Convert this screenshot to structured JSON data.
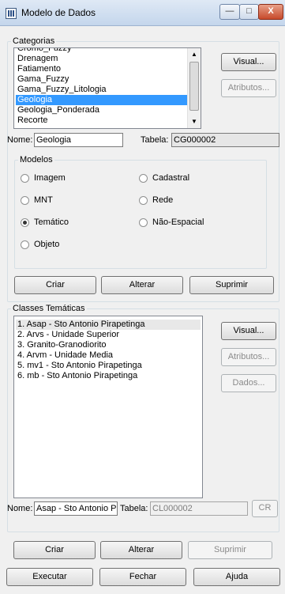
{
  "window": {
    "title": "Modelo de Dados",
    "buttons": {
      "minimize": "—",
      "maximize": "□",
      "close": "X"
    }
  },
  "categorias": {
    "legend": "Categorias",
    "partial_item": "Cromo_Fuzzy",
    "items": [
      "Drenagem",
      "Fatiamento",
      "Gama_Fuzzy",
      "Gama_Fuzzy_Litologia",
      "Geologia",
      "Geologia_Ponderada",
      "Recorte"
    ],
    "selected": "Geologia",
    "visual_label": "Visual...",
    "atributos_label": "Atributos...",
    "nome_label": "Nome:",
    "nome_value": "Geologia",
    "tabela_label": "Tabela:",
    "tabela_value": "CG000002"
  },
  "modelos": {
    "legend": "Modelos",
    "options": [
      "Imagem",
      "Cadastral",
      "MNT",
      "Rede",
      "Temático",
      "Não-Espacial",
      "Objeto"
    ],
    "selected": "Temático"
  },
  "cat_actions": {
    "criar": "Criar",
    "alterar": "Alterar",
    "suprimir": "Suprimir"
  },
  "classes": {
    "legend": "Classes Temáticas",
    "items": [
      "1. Asap - Sto Antonio Pirapetinga",
      "2. Arvs - Unidade Superior",
      "3. Granito-Granodiorito",
      "4. Arvm - Unidade Media",
      "5. mv1 - Sto Antonio Pirapetinga",
      "6. mb - Sto Antonio Pirapetinga"
    ],
    "highlighted": "1. Asap - Sto Antonio Pirapetinga",
    "visual_label": "Visual...",
    "atributos_label": "Atributos...",
    "dados_label": "Dados...",
    "nome_label": "Nome:",
    "nome_value": "Asap - Sto Antonio P",
    "tabela_label": "Tabela:",
    "tabela_value": "CL000002",
    "cr_label": "CR",
    "criar": "Criar",
    "alterar": "Alterar",
    "suprimir": "Suprimir"
  },
  "footer": {
    "executar": "Executar",
    "fechar": "Fechar",
    "ajuda": "Ajuda"
  },
  "colors": {
    "selection": "#3399ff",
    "window_bg": "#f0f0f0",
    "titlebar": "#c4d6ec"
  }
}
